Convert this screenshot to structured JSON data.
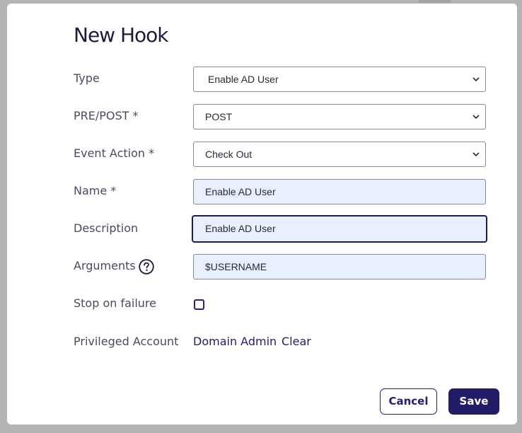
{
  "dialog": {
    "title": "New Hook"
  },
  "form": {
    "type": {
      "label": "Type",
      "value": "Enable AD User"
    },
    "pre_post": {
      "label": "PRE/POST *",
      "value": "POST"
    },
    "event_action": {
      "label": "Event Action *",
      "value": "Check Out"
    },
    "name": {
      "label": "Name *",
      "value": "Enable AD User"
    },
    "description": {
      "label": "Description",
      "value": "Enable AD User"
    },
    "arguments": {
      "label": "Arguments",
      "value": "$USERNAME",
      "help_icon": "question-circle-icon"
    },
    "stop_on_failure": {
      "label": "Stop on failure",
      "checked": false
    },
    "privileged_account": {
      "label": "Privileged Account",
      "value_link": "Domain Admin",
      "clear_link": "Clear"
    }
  },
  "footer": {
    "cancel_label": "Cancel",
    "save_label": "Save"
  },
  "colors": {
    "accent": "#221b66",
    "input_fill": "#e8f0fd",
    "label_text": "#4b4a60"
  }
}
